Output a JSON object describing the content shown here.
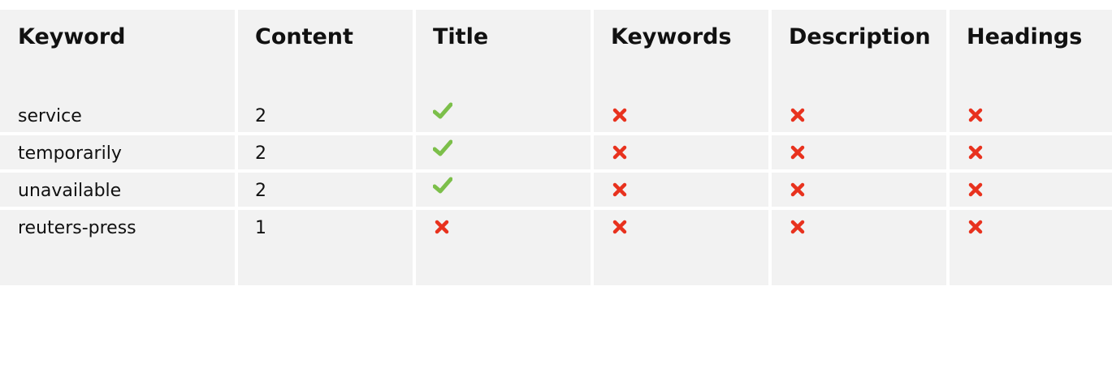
{
  "table": {
    "columns": [
      "Keyword",
      "Content",
      "Title",
      "Keywords",
      "Description",
      "Headings"
    ],
    "rows": [
      {
        "keyword": "service",
        "content": "2",
        "title": "check",
        "keywords": "cross",
        "description": "cross",
        "headings": "cross"
      },
      {
        "keyword": "temporarily",
        "content": "2",
        "title": "check",
        "keywords": "cross",
        "description": "cross",
        "headings": "cross"
      },
      {
        "keyword": "unavailable",
        "content": "2",
        "title": "check",
        "keywords": "cross",
        "description": "cross",
        "headings": "cross"
      },
      {
        "keyword": "reuters-press",
        "content": "1",
        "title": "cross",
        "keywords": "cross",
        "description": "cross",
        "headings": "cross"
      }
    ]
  },
  "colors": {
    "header_bg": "#f2f2f2",
    "check": "#7cbf4a",
    "cross": "#e8321e"
  },
  "icons": {
    "check": "check-icon",
    "cross": "cross-icon"
  }
}
